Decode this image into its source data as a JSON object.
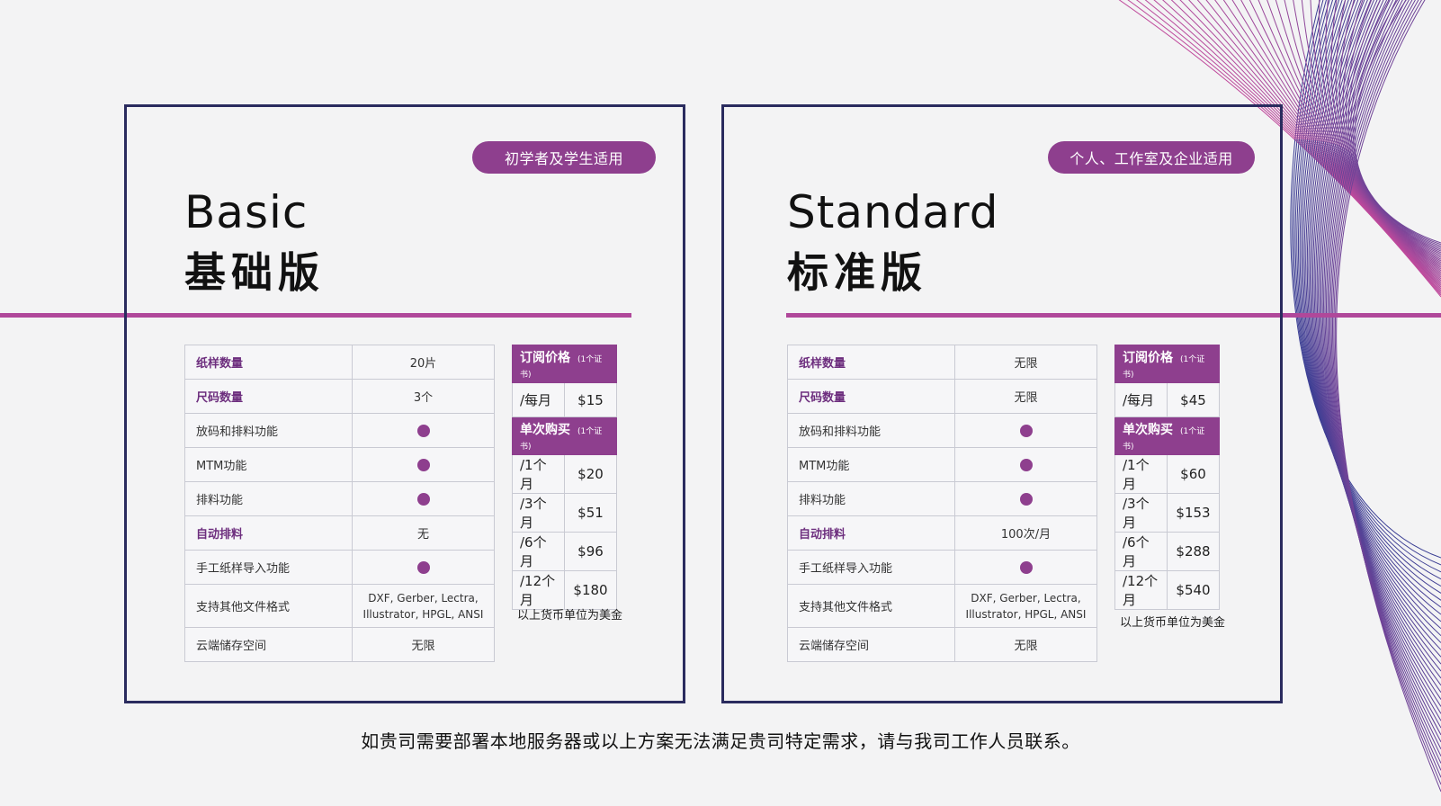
{
  "basic": {
    "badge": "初学者及学生适用",
    "title_en": "Basic",
    "title_zh": "基础版",
    "features": [
      {
        "label": "纸样数量",
        "value": "20片",
        "bold": true
      },
      {
        "label": "尺码数量",
        "value": "3个",
        "bold": true
      },
      {
        "label": "放码和排料功能",
        "value": "",
        "dot": true
      },
      {
        "label": "MTM功能",
        "value": "",
        "dot": true
      },
      {
        "label": "排料功能",
        "value": "",
        "dot": true
      },
      {
        "label": "自动排料",
        "value": "无",
        "bold": true
      },
      {
        "label": "手工纸样导入功能",
        "value": "",
        "dot": true
      },
      {
        "label": "支持其他文件格式",
        "value": "DXF, Gerber, Lectra, Illustrator, HPGL, ANSI"
      },
      {
        "label": "云端储存空间",
        "value": "无限"
      }
    ],
    "subscription": {
      "header": "订阅价格",
      "header_sub": "(1个证书)",
      "rows": [
        {
          "period": "/每月",
          "price": "$15"
        }
      ]
    },
    "single": {
      "header": "单次购买",
      "header_sub": "(1个证书)",
      "rows": [
        {
          "period": "/1个月",
          "price": "$20"
        },
        {
          "period": "/3个月",
          "price": "$51"
        },
        {
          "period": "/6个月",
          "price": "$96"
        },
        {
          "period": "/12个月",
          "price": "$180"
        }
      ]
    },
    "note": "以上货币单位为美金"
  },
  "standard": {
    "badge": "个人、工作室及企业适用",
    "title_en": "Standard",
    "title_zh": "标准版",
    "features": [
      {
        "label": "纸样数量",
        "value": "无限",
        "bold": true
      },
      {
        "label": "尺码数量",
        "value": "无限",
        "bold": true
      },
      {
        "label": "放码和排料功能",
        "value": "",
        "dot": true
      },
      {
        "label": "MTM功能",
        "value": "",
        "dot": true
      },
      {
        "label": "排料功能",
        "value": "",
        "dot": true
      },
      {
        "label": "自动排料",
        "value": "100次/月",
        "bold": true
      },
      {
        "label": "手工纸样导入功能",
        "value": "",
        "dot": true
      },
      {
        "label": "支持其他文件格式",
        "value": "DXF, Gerber, Lectra, Illustrator, HPGL, ANSI"
      },
      {
        "label": "云端储存空间",
        "value": "无限"
      }
    ],
    "subscription": {
      "header": "订阅价格",
      "header_sub": "(1个证书)",
      "rows": [
        {
          "period": "/每月",
          "price": "$45"
        }
      ]
    },
    "single": {
      "header": "单次购买",
      "header_sub": "(1个证书)",
      "rows": [
        {
          "period": "/1个月",
          "price": "$60"
        },
        {
          "period": "/3个月",
          "price": "$153"
        },
        {
          "period": "/6个月",
          "price": "$288"
        },
        {
          "period": "/12个月",
          "price": "$540"
        }
      ]
    },
    "note": "以上货币单位为美金"
  },
  "footer": "如贵司需要部署本地服务器或以上方案无法满足贵司特定需求，请与我司工作人员联系。",
  "colors": {
    "accent": "#8e3f8e",
    "line": "#b0489a",
    "border": "#2a2b5e",
    "wave_blue": "#3b3f94",
    "wave_pink": "#c04a9c"
  }
}
